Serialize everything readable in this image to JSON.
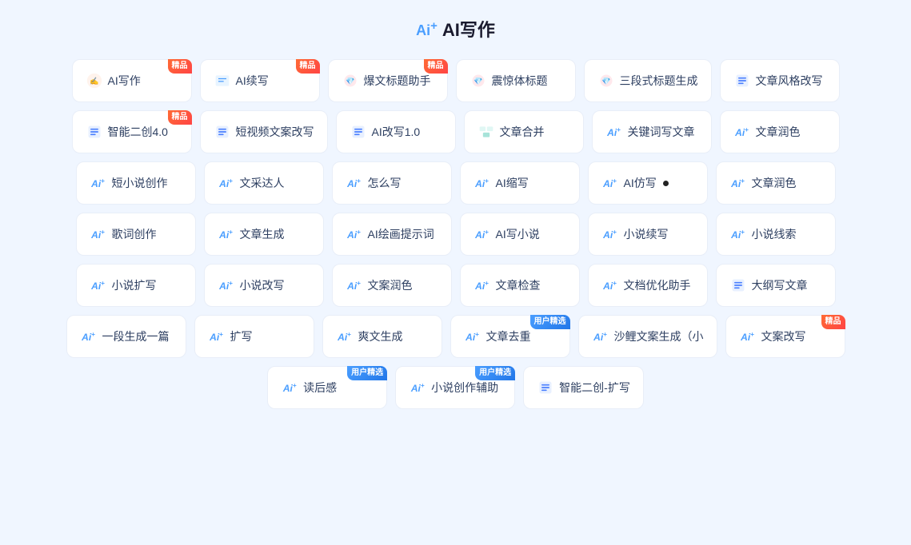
{
  "page": {
    "title": "AI写作",
    "title_prefix": "Ai+"
  },
  "rows": [
    [
      {
        "id": "ai-writing",
        "icon": "✍",
        "icon_color": "icon-orange",
        "label": "AI写作",
        "badge": "精品",
        "badge_type": "jingpin",
        "prefix": "icon"
      },
      {
        "id": "ai-continue",
        "icon": "📝",
        "icon_color": "icon-blue",
        "label": "AI续写",
        "badge": "精品",
        "badge_type": "jingpin",
        "prefix": "icon"
      },
      {
        "id": "explode-title",
        "icon": "🔥",
        "icon_color": "icon-red",
        "label": "爆文标题助手",
        "badge": "精品",
        "badge_type": "jingpin",
        "prefix": "icon"
      },
      {
        "id": "shock-title",
        "icon": "💎",
        "icon_color": "icon-pink",
        "label": "震惊体标题",
        "badge": "",
        "badge_type": "",
        "prefix": "icon"
      },
      {
        "id": "three-title",
        "icon": "💎",
        "icon_color": "icon-pink",
        "label": "三段式标题生成",
        "badge": "",
        "badge_type": "",
        "prefix": "icon"
      },
      {
        "id": "style-rewrite",
        "icon": "◫",
        "icon_color": "icon-blue",
        "label": "文章风格改写",
        "badge": "",
        "badge_type": "",
        "prefix": "icon"
      }
    ],
    [
      {
        "id": "smart-create4",
        "icon": "◫",
        "icon_color": "icon-blue",
        "label": "智能二创4.0",
        "badge": "精品",
        "badge_type": "jingpin",
        "prefix": "icon"
      },
      {
        "id": "short-video",
        "icon": "◫",
        "icon_color": "icon-blue",
        "label": "短视频文案改写",
        "badge": "",
        "badge_type": "",
        "prefix": "icon"
      },
      {
        "id": "ai-rewrite1",
        "icon": "◫",
        "icon_color": "icon-blue",
        "label": "AI改写1.0",
        "badge": "",
        "badge_type": "",
        "prefix": "icon"
      },
      {
        "id": "article-merge",
        "icon": "⊞",
        "icon_color": "icon-teal",
        "label": "文章合并",
        "badge": "",
        "badge_type": "",
        "prefix": "icon"
      },
      {
        "id": "keyword-write",
        "icon": "✦",
        "icon_color": "icon-blue",
        "label": "关键词写文章",
        "badge": "",
        "badge_type": "",
        "prefix": "ai"
      },
      {
        "id": "article-polish1",
        "icon": "✦",
        "icon_color": "icon-blue",
        "label": "文章润色",
        "badge": "",
        "badge_type": "",
        "prefix": "ai"
      }
    ],
    [
      {
        "id": "short-novel",
        "icon": "✦",
        "icon_color": "icon-blue",
        "label": "短小说创作",
        "badge": "",
        "badge_type": "",
        "prefix": "ai"
      },
      {
        "id": "writing-talent",
        "icon": "✦",
        "icon_color": "icon-blue",
        "label": "文采达人",
        "badge": "",
        "badge_type": "",
        "prefix": "ai"
      },
      {
        "id": "how-to-write",
        "icon": "✦",
        "icon_color": "icon-blue",
        "label": "怎么写",
        "badge": "",
        "badge_type": "",
        "prefix": "ai"
      },
      {
        "id": "ai-shorten",
        "icon": "✦",
        "icon_color": "icon-blue",
        "label": "AI缩写",
        "badge": "",
        "badge_type": "",
        "prefix": "ai"
      },
      {
        "id": "ai-imitate",
        "icon": "✦",
        "icon_color": "icon-blue",
        "label": "AI仿写",
        "badge": "",
        "badge_type": "",
        "prefix": "ai"
      },
      {
        "id": "article-polish2",
        "icon": "✦",
        "icon_color": "icon-blue",
        "label": "文章润色",
        "badge": "",
        "badge_type": "",
        "prefix": "ai"
      }
    ],
    [
      {
        "id": "lyric-create",
        "icon": "✦",
        "icon_color": "icon-blue",
        "label": "歌词创作",
        "badge": "",
        "badge_type": "",
        "prefix": "ai"
      },
      {
        "id": "article-gen",
        "icon": "✦",
        "icon_color": "icon-blue",
        "label": "文章生成",
        "badge": "",
        "badge_type": "",
        "prefix": "ai"
      },
      {
        "id": "ai-paint-prompt",
        "icon": "✦",
        "icon_color": "icon-blue",
        "label": "AI绘画提示词",
        "badge": "",
        "badge_type": "",
        "prefix": "ai"
      },
      {
        "id": "ai-write-novel",
        "icon": "✦",
        "icon_color": "icon-blue",
        "label": "AI写小说",
        "badge": "",
        "badge_type": "",
        "prefix": "ai"
      },
      {
        "id": "novel-continue",
        "icon": "✦",
        "icon_color": "icon-blue",
        "label": "小说续写",
        "badge": "",
        "badge_type": "",
        "prefix": "ai"
      },
      {
        "id": "novel-clue",
        "icon": "✦",
        "icon_color": "icon-blue",
        "label": "小说线索",
        "badge": "",
        "badge_type": "",
        "prefix": "ai"
      }
    ],
    [
      {
        "id": "novel-expand",
        "icon": "✦",
        "icon_color": "icon-blue",
        "label": "小说扩写",
        "badge": "",
        "badge_type": "",
        "prefix": "ai"
      },
      {
        "id": "novel-rewrite",
        "icon": "✦",
        "icon_color": "icon-blue",
        "label": "小说改写",
        "badge": "",
        "badge_type": "",
        "prefix": "ai"
      },
      {
        "id": "copy-polish",
        "icon": "✦",
        "icon_color": "icon-blue",
        "label": "文案润色",
        "badge": "",
        "badge_type": "",
        "prefix": "ai"
      },
      {
        "id": "article-check",
        "icon": "✦",
        "icon_color": "icon-blue",
        "label": "文章检查",
        "badge": "",
        "badge_type": "",
        "prefix": "ai"
      },
      {
        "id": "doc-optimize",
        "icon": "✦",
        "icon_color": "icon-blue",
        "label": "文档优化助手",
        "badge": "",
        "badge_type": "",
        "prefix": "ai"
      },
      {
        "id": "outline-write",
        "icon": "◫",
        "icon_color": "icon-blue",
        "label": "大纲写文章",
        "badge": "",
        "badge_type": "",
        "prefix": "icon"
      }
    ],
    [
      {
        "id": "one-article",
        "icon": "✦",
        "icon_color": "icon-blue",
        "label": "一段生成一篇",
        "badge": "",
        "badge_type": "",
        "prefix": "ai"
      },
      {
        "id": "expand-write",
        "icon": "✦",
        "icon_color": "icon-blue",
        "label": "扩写",
        "badge": "",
        "badge_type": "",
        "prefix": "ai"
      },
      {
        "id": "cool-gen",
        "icon": "✦",
        "icon_color": "icon-blue",
        "label": "爽文生成",
        "badge": "",
        "badge_type": "",
        "prefix": "ai"
      },
      {
        "id": "article-dedup",
        "icon": "✦",
        "icon_color": "icon-blue",
        "label": "文章去重",
        "badge": "用户精选",
        "badge_type": "yonghu",
        "prefix": "ai"
      },
      {
        "id": "sha-copy-gen",
        "icon": "✦",
        "icon_color": "icon-blue",
        "label": "沙鲤文案生成（小",
        "badge": "",
        "badge_type": "",
        "prefix": "ai"
      },
      {
        "id": "copy-rewrite",
        "icon": "✦",
        "icon_color": "icon-blue",
        "label": "文案改写",
        "badge": "精品",
        "badge_type": "jingpin",
        "prefix": "ai"
      }
    ],
    [
      {
        "id": "read-feeling",
        "icon": "✦",
        "icon_color": "icon-blue",
        "label": "读后感",
        "badge": "用户精选",
        "badge_type": "yonghu",
        "prefix": "ai"
      },
      {
        "id": "novel-assist",
        "icon": "✦",
        "icon_color": "icon-blue",
        "label": "小说创作辅助",
        "badge": "用户精选",
        "badge_type": "yonghu",
        "prefix": "ai"
      },
      {
        "id": "smart-create-expand",
        "icon": "◫",
        "icon_color": "icon-blue",
        "label": "智能二创-扩写",
        "badge": "",
        "badge_type": "",
        "prefix": "icon"
      }
    ]
  ]
}
